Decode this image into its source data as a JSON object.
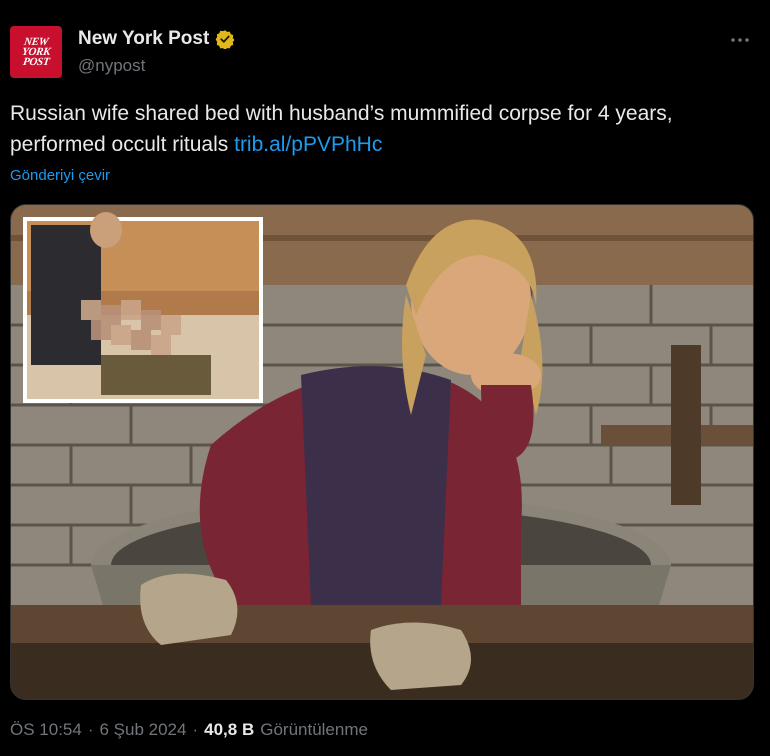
{
  "account": {
    "display_name": "New York Post",
    "handle": "@nypost",
    "avatar_lines": [
      "NEW",
      "YORK",
      "POST"
    ],
    "verified_badge_color": "#e2b719"
  },
  "post": {
    "text": "Russian wife shared bed with husband’s mummified corpse for 4 years, performed occult rituals",
    "link_text": "trib.al/pPVPhHc",
    "translate_label": "Gönderiyi çevir"
  },
  "footer": {
    "time": "ÖS 10:54",
    "separator_1": "·",
    "date": "6 Şub 2024",
    "separator_2": "·",
    "views_count": "40,8 B",
    "views_label": "Görüntülenme"
  },
  "colors": {
    "background": "#000000",
    "text": "#e7e9ea",
    "muted": "#71767b",
    "link": "#1d9bf0",
    "brand_red": "#c8102e"
  },
  "icons": {
    "more": "more-horizontal-icon",
    "verified": "verified-badge-icon"
  }
}
